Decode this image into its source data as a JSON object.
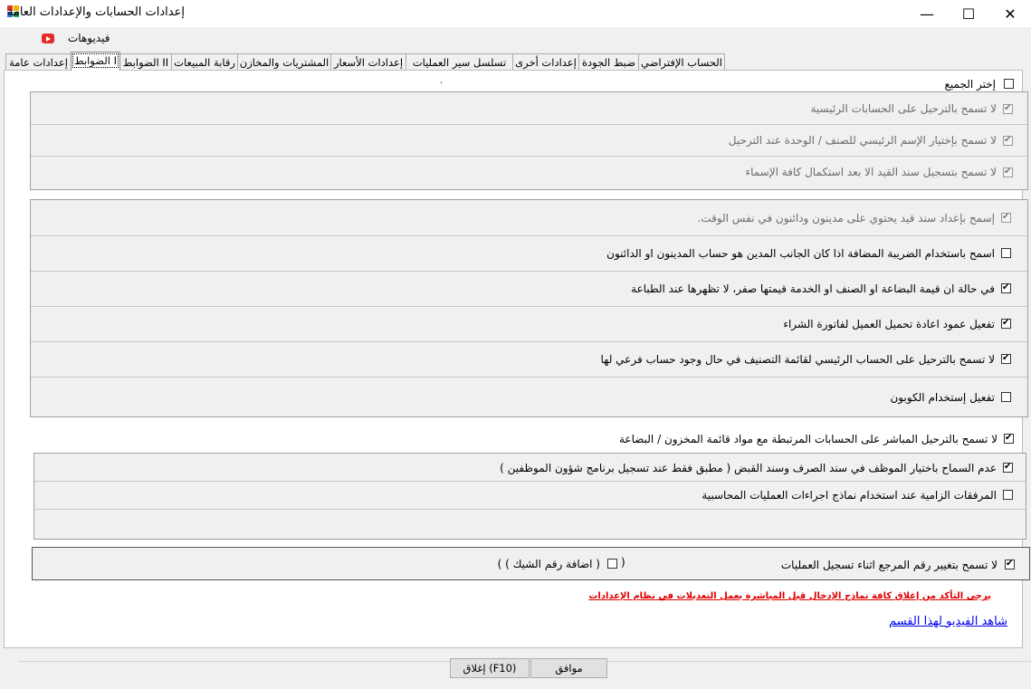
{
  "window": {
    "title": "إعدادات الحسابات والإعدادات العامة",
    "minimize": "—",
    "maximize": "☐",
    "close": "✕"
  },
  "toolbar": {
    "videos_label": "فيديوهات"
  },
  "tabs": [
    {
      "label": "الحساب الإفتراضي"
    },
    {
      "label": "ضبط الجودة"
    },
    {
      "label": "إعدادات أخرى"
    },
    {
      "label": "تسلسل سير العمليات"
    },
    {
      "label": "إعدادات الأسعار"
    },
    {
      "label": "المشتريات والمخازن"
    },
    {
      "label": "رقابة المبيعات"
    },
    {
      "label": "الضوابط II"
    },
    {
      "label": "الضوابط I"
    },
    {
      "label": "إعدادات عامة"
    }
  ],
  "active_tab": "الضوابط I",
  "select_all": {
    "label": "إختر الجميع",
    "checked": false
  },
  "group1": [
    {
      "label": "لا تسمح بالترحيل على الحسابات الرئيسية",
      "checked": true,
      "enabled": false
    },
    {
      "label": "لا تسمح بإختيار الإسم الرئيسي للصنف / الوحدة عند الترحيل",
      "checked": true,
      "enabled": false
    },
    {
      "label": "لا تسمح بتسجيل سند القيد الا بعد استكمال كافة الإسماء",
      "checked": true,
      "enabled": false
    }
  ],
  "group2": [
    {
      "label": "إسمح بإعداد سند قيد يحتوي على مدينون ودائنون في نفس الوقت.",
      "checked": true,
      "enabled": false
    },
    {
      "label": "اسمح باستخدام الضريبة المضافة اذا كان الجانب المدين هو حساب المدينون او الدائنون",
      "checked": false,
      "enabled": true
    },
    {
      "label": "في حالة ان قيمة البضاعة او الصنف او الخدمة قيمتها صفر، لا تظهرها عند الطباعة",
      "checked": true,
      "enabled": true
    },
    {
      "label": "تفعيل عمود اعادة تحميل العميل لفاتورة الشراء",
      "checked": true,
      "enabled": true
    },
    {
      "label": "لا تسمح بالترحيل على الحساب الرئيسي لقائمة التصنيف في حال وجود حساب فرعي لها",
      "checked": true,
      "enabled": true
    },
    {
      "label": "تفعيل إستخدام الكوبون",
      "checked": false,
      "enabled": true
    }
  ],
  "direct_posting": {
    "label": "لا تسمح بالترحيل المباشر على الحسابات المرتبطة مع مواد قائمة المخزون / البضاعة",
    "checked": true
  },
  "group3": [
    {
      "label": "عدم السماح باختيار الموظف في سند الصرف وسند القبض ( مطبق فقط عند تسجيل برنامج شؤون الموظفين )",
      "checked": true
    },
    {
      "label": "المرفقات الزامية عند استخدام نماذج اجراءات العمليات المحاسبية",
      "checked": false
    }
  ],
  "reference": {
    "label": "لا تسمح بتغيير رقم المرجع اثناء تسجيل العمليات",
    "checked": true,
    "open_paren": "(",
    "check_number_label": "( اضافة رقم الشيك ) )",
    "check_number_checked": false
  },
  "warning": "يرجى التأكد من إغلاق كافة نماذج الإدخال قبل المباشرة بعمل التعديلات في نظام الإعدادات",
  "video_link": "شاهد الفيديو لهذا القسم",
  "buttons": {
    "ok": "موافق",
    "close": "إغلاق (F10)"
  },
  "colors": {
    "warning": "#e00000",
    "link": "#0000ee",
    "youtube": "#e52d27"
  }
}
